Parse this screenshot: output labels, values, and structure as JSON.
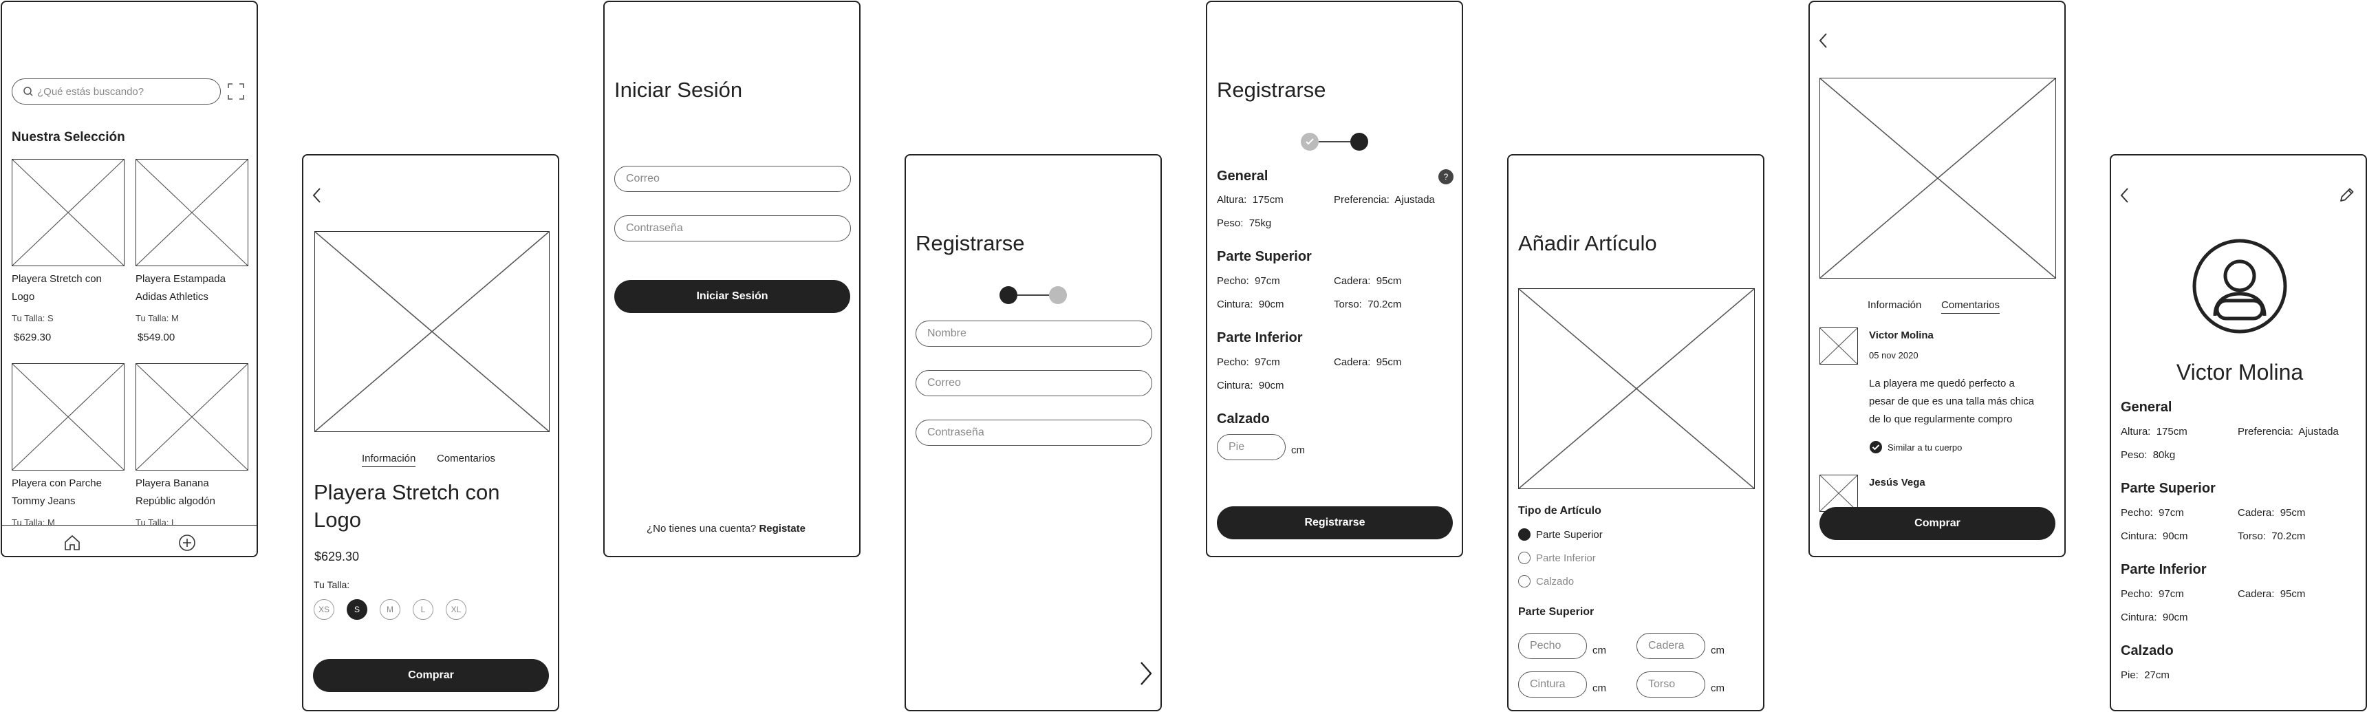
{
  "home": {
    "search_placeholder": "¿Qué estás buscando?",
    "section_title": "Nuestra Selección",
    "products": [
      {
        "name_line1": "Playera Stretch con",
        "name_line2": "Logo",
        "size": "Tu Talla: S",
        "price": "$629.30"
      },
      {
        "name_line1": "Playera Estampada",
        "name_line2": "Adidas Athletics",
        "size": "Tu Talla: M",
        "price": "$549.00"
      },
      {
        "name_line1": "Playera con Parche",
        "name_line2": "Tommy Jeans",
        "size": "Tu Talla: M",
        "price": ""
      },
      {
        "name_line1": "Playera Banana",
        "name_line2": "Repúblic algodón",
        "size": "Tu Talla: L",
        "price": ""
      }
    ]
  },
  "product": {
    "tabs": [
      "Información",
      "Comentarios"
    ],
    "title_line1": "Playera Stretch con",
    "title_line2": "Logo",
    "price": "$629.30",
    "size_label": "Tu Talla:",
    "sizes": [
      "XS",
      "S",
      "M",
      "L",
      "XL"
    ],
    "selected_size": "S",
    "buy": "Comprar"
  },
  "login": {
    "title": "Iniciar Sesión",
    "email_placeholder": "Correo",
    "password_placeholder": "Contraseña",
    "submit": "Iniciar Sesión",
    "no_account": "¿No tienes una cuenta?",
    "register_link": "Registate"
  },
  "register1": {
    "title": "Registrarse",
    "name_placeholder": "Nombre",
    "email_placeholder": "Correo",
    "password_placeholder": "Contraseña"
  },
  "register2": {
    "title": "Registrarse",
    "general_title": "General",
    "help": "?",
    "height_label": "Altura:",
    "height_value": "175cm",
    "pref_label": "Preferencia:",
    "pref_value": "Ajustada",
    "weight_label": "Peso:",
    "weight_value": "75kg",
    "upper_title": "Parte Superior",
    "chest_label": "Pecho:",
    "chest_value": "97cm",
    "hip_label": "Cadera:",
    "hip_value": "95cm",
    "waist_label": "Cintura:",
    "waist_value": "90cm",
    "torso_label": "Torso:",
    "torso_value": "70.2cm",
    "lower_title": "Parte Inferior",
    "lchest_label": "Pecho:",
    "lchest_value": "97cm",
    "lhip_label": "Cadera:",
    "lhip_value": "95cm",
    "lwaist_label": "Cintura:",
    "lwaist_value": "90cm",
    "shoes_title": "Calzado",
    "foot_placeholder": "Pie",
    "unit": "cm",
    "submit": "Registrarse"
  },
  "add": {
    "title": "Añadir Artículo",
    "type_title": "Tipo de Artículo",
    "types": [
      "Parte Superior",
      "Parte Inferior",
      "Calzado"
    ],
    "upper_title": "Parte Superior",
    "fields": [
      "Pecho",
      "Cadera",
      "Cintura",
      "Torso"
    ],
    "unit": "cm"
  },
  "comments": {
    "tabs": [
      "Información",
      "Comentarios"
    ],
    "author": "Victor Molina",
    "date": "05 nov 2020",
    "text_line1": "La playera me quedó perfecto a",
    "text_line2": "pesar de que es una talla más chica",
    "text_line3": "de lo que regularmente compro",
    "fit": "Similar a tu cuerpo",
    "author2": "Jesús Vega",
    "buy": "Comprar"
  },
  "profile": {
    "name": "Victor Molina",
    "general_title": "General",
    "height_label": "Altura:",
    "height_value": "175cm",
    "pref_label": "Preferencia:",
    "pref_value": "Ajustada",
    "weight_label": "Peso:",
    "weight_value": "80kg",
    "upper_title": "Parte Superior",
    "chest_label": "Pecho:",
    "chest_value": "97cm",
    "hip_label": "Cadera:",
    "hip_value": "95cm",
    "waist_label": "Cintura:",
    "waist_value": "90cm",
    "torso_label": "Torso:",
    "torso_value": "70.2cm",
    "lower_title": "Parte Inferior",
    "lchest_label": "Pecho:",
    "lchest_value": "97cm",
    "lhip_label": "Cadera:",
    "lhip_value": "95cm",
    "lwaist_label": "Cintura:",
    "lwaist_value": "90cm",
    "shoes_title": "Calzado",
    "foot_label": "Pie:",
    "foot_value": "27cm"
  }
}
